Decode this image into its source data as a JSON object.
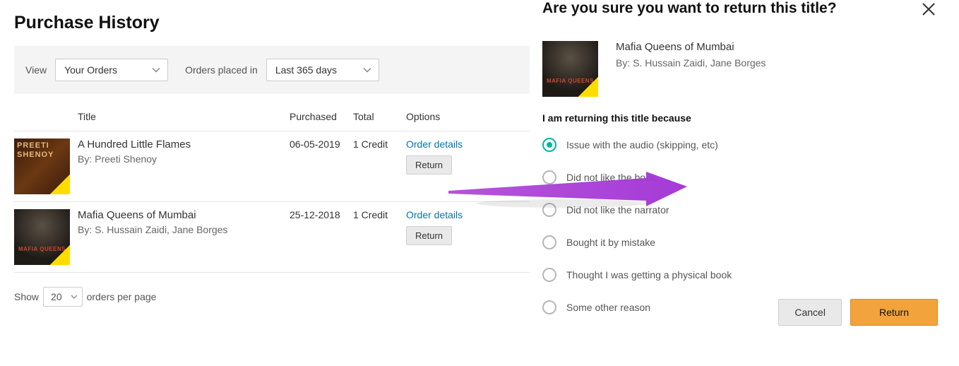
{
  "page": {
    "title": "Purchase History"
  },
  "filters": {
    "view_label": "View",
    "view_value": "Your Orders",
    "placed_label": "Orders placed in",
    "placed_value": "Last 365 days"
  },
  "columns": {
    "title": "Title",
    "purchased": "Purchased",
    "total": "Total",
    "options": "Options"
  },
  "orders": [
    {
      "title": "A Hundred Little Flames",
      "by": "By: Preeti Shenoy",
      "purchased": "06-05-2019",
      "total": "1 Credit",
      "details_label": "Order details",
      "return_label": "Return"
    },
    {
      "title": "Mafia Queens of Mumbai",
      "by": "By: S. Hussain Zaidi, Jane Borges",
      "purchased": "25-12-2018",
      "total": "1 Credit",
      "details_label": "Order details",
      "return_label": "Return"
    }
  ],
  "pager": {
    "show_label": "Show",
    "value": "20",
    "suffix": "orders per page"
  },
  "dialog": {
    "title": "Are you sure you want to return this title?",
    "item_title": "Mafia Queens of Mumbai",
    "item_by": "By: S. Hussain Zaidi, Jane Borges",
    "reason_heading": "I am returning this title because",
    "reasons": [
      {
        "label": "Issue with the audio (skipping, etc)",
        "selected": true
      },
      {
        "label": "Did not like the book",
        "selected": false
      },
      {
        "label": "Did not like the narrator",
        "selected": false
      },
      {
        "label": "Bought it by mistake",
        "selected": false
      },
      {
        "label": "Thought I was getting a physical book",
        "selected": false
      },
      {
        "label": "Some other reason",
        "selected": false
      }
    ],
    "cancel": "Cancel",
    "return": "Return"
  },
  "cover2_text": "MAFIA\nQUEENS"
}
